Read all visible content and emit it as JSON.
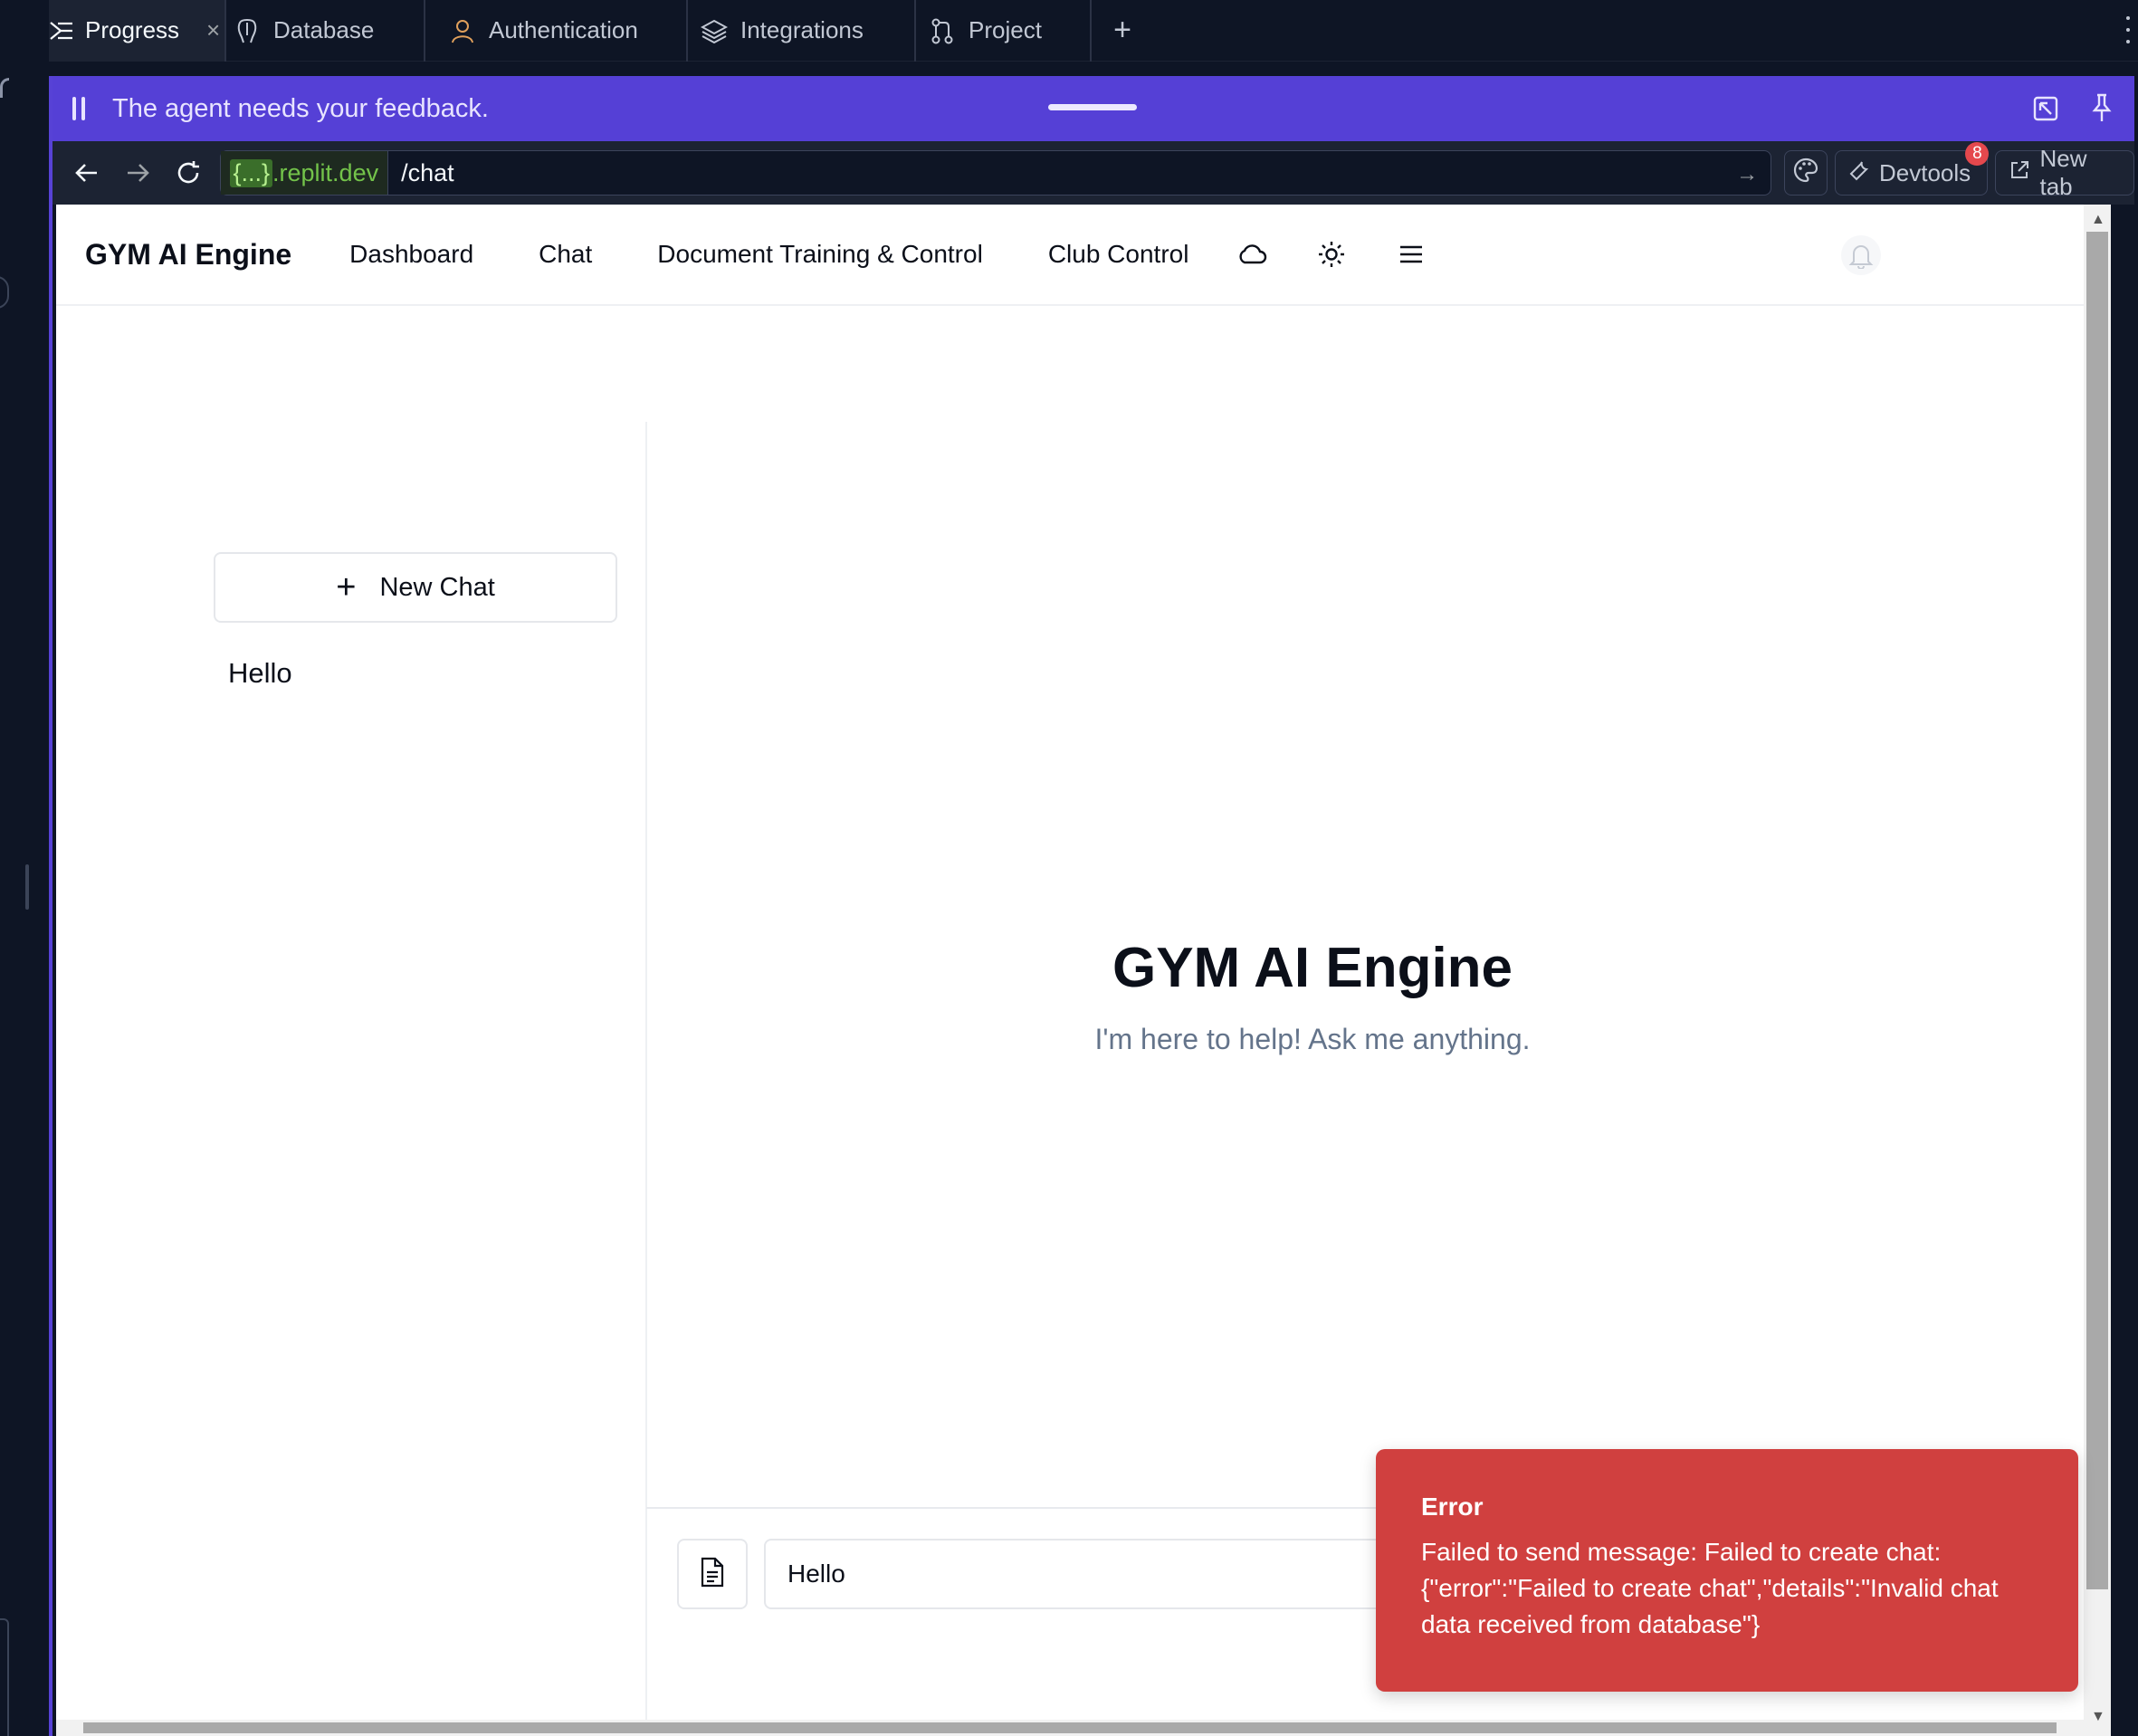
{
  "tabs": [
    {
      "label": "Progress",
      "icon": "progress-icon",
      "active": true
    },
    {
      "label": "Database",
      "icon": "database-icon"
    },
    {
      "label": "Authentication",
      "icon": "user-icon"
    },
    {
      "label": "Integrations",
      "icon": "layers-icon"
    },
    {
      "label": "Project",
      "icon": "git-branch-icon"
    }
  ],
  "banner": {
    "text": "The agent needs your feedback."
  },
  "address": {
    "host_highlight": "{...}",
    "host_suffix": ".replit.dev",
    "path": "/chat",
    "devtools_label": "Devtools",
    "devtools_badge": "8",
    "newtab_label": "New tab"
  },
  "app": {
    "brand": "GYM AI Engine",
    "nav": [
      "Dashboard",
      "Chat",
      "Document Training & Control",
      "Club Control"
    ],
    "new_chat_label": "New Chat",
    "history": [
      "Hello"
    ],
    "welcome_title": "GYM AI Engine",
    "welcome_subtitle": "I'm here to help! Ask me anything.",
    "input_value": "Hello"
  },
  "toast": {
    "title": "Error",
    "message": "Failed to send message: Failed to create chat: {\"error\":\"Failed to create chat\",\"details\":\"Invalid chat data received from database\"}"
  },
  "colors": {
    "banner": "#5540d6",
    "toast": "#d0403f",
    "url_green": "#73c34a",
    "badge": "#e5484d"
  }
}
